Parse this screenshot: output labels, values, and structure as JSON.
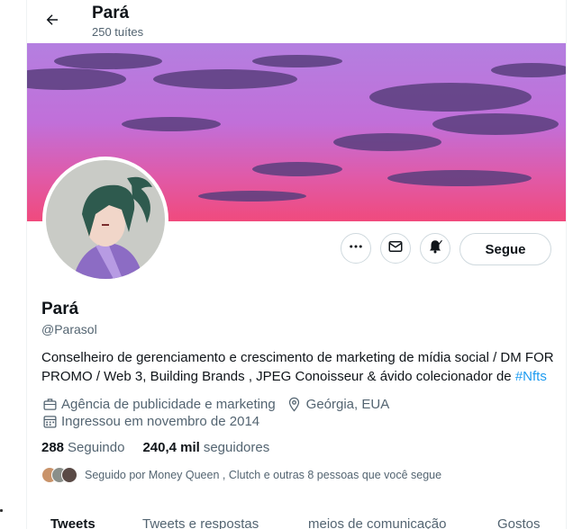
{
  "header": {
    "title": "Pará",
    "subtitle": "250 tuítes"
  },
  "profile": {
    "name": "Pará",
    "handle": "@Parasol",
    "bio_text": "Conselheiro de gerenciamento e crescimento de marketing de mídia social / DM FOR PROMO / Web 3, Building Brands , JPEG Conoisseur & ávido colecionador de ",
    "bio_link": "#Nfts",
    "category": "Agência de publicidade e marketing",
    "location": "Geórgia, EUA",
    "joined": "Ingressou em novembro de 2014",
    "following_count": "288",
    "following_label": "Seguindo",
    "followers_count": "240,4 mil",
    "followers_label": "seguidores",
    "followed_by": "Seguido por Money Queen , Clutch e outras 8 pessoas que você segue"
  },
  "actions": {
    "follow_label": "Segue"
  },
  "tabs": [
    {
      "label": "Tweets",
      "active": true
    },
    {
      "label": "Tweets e respostas",
      "active": false
    },
    {
      "label": "meios de comunicação",
      "active": false
    },
    {
      "label": "Gostos",
      "active": false
    }
  ],
  "colors": {
    "accent": "#1d9bf0",
    "text": "#0f1419",
    "muted": "#536471",
    "border": "#cfd9de"
  },
  "icons": {
    "back": "arrow-left-icon",
    "more": "more-icon",
    "message": "envelope-icon",
    "notify": "bell-icon",
    "category": "briefcase-icon",
    "location": "location-pin-icon",
    "joined": "calendar-icon"
  }
}
